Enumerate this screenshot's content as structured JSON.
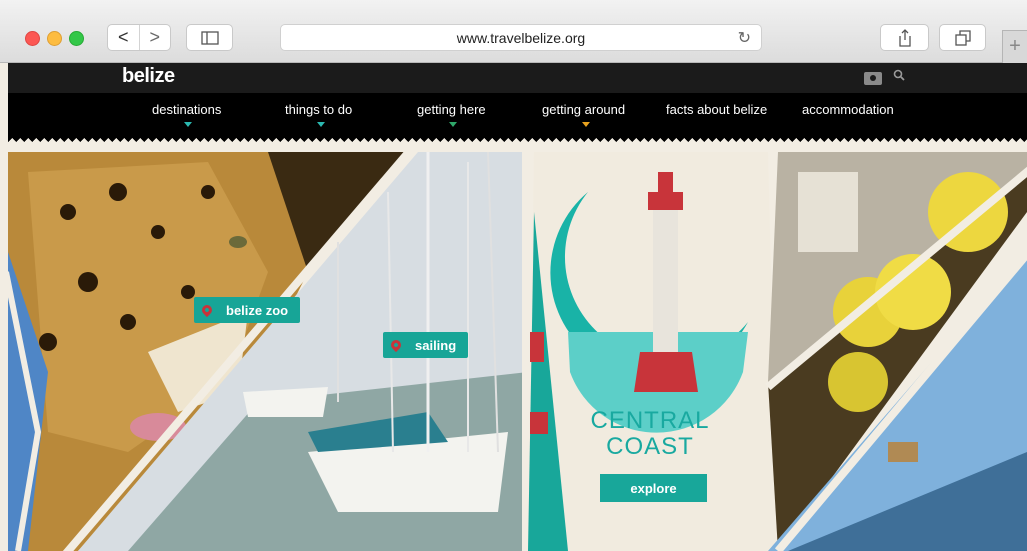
{
  "browser": {
    "url": "www.travelbelize.org",
    "back_glyph": "<",
    "forward_glyph": ">",
    "new_tab_glyph": "+"
  },
  "site": {
    "logo": "belize",
    "nav": [
      {
        "label": "destinations",
        "caret_color": "#2bb8b0"
      },
      {
        "label": "things to do",
        "caret_color": "#2bb8b0"
      },
      {
        "label": "getting here",
        "caret_color": "#2fa86a"
      },
      {
        "label": "getting around",
        "caret_color": "#e8a21f"
      },
      {
        "label": "facts about belize"
      },
      {
        "label": "accommodation"
      }
    ]
  },
  "hero": {
    "badges": {
      "zoo": "belize zoo",
      "sailing": "sailing"
    },
    "feature": {
      "title_line1": "CENTRAL",
      "title_line2": "COAST",
      "button": "explore"
    }
  },
  "colors": {
    "teal": "#17a597",
    "red_pin": "#c8343a",
    "nav_bg": "#000000"
  }
}
